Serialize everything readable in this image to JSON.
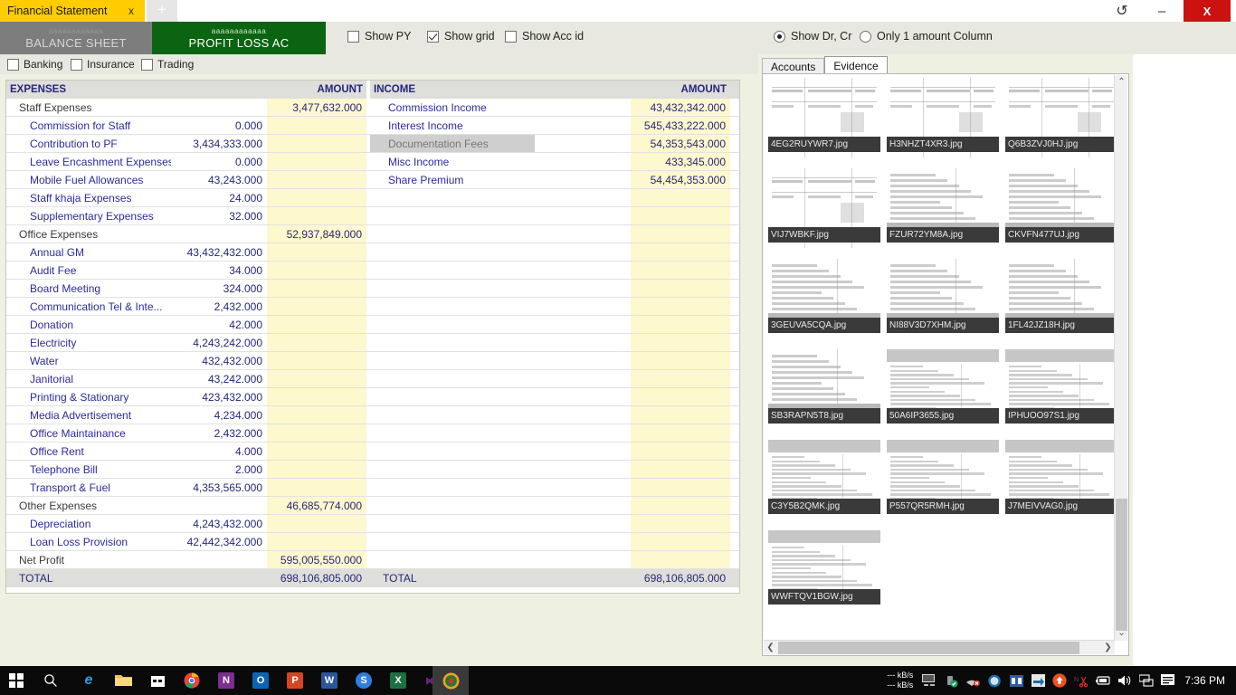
{
  "window": {
    "tab_title": "Financial Statement",
    "tab_close": "x",
    "new_tab": "+",
    "refresh": "↺",
    "minimize": "–",
    "close": "X"
  },
  "module_tabs": [
    {
      "sub": "aaaaaaaaaaaa",
      "main": "BALANCE SHEET",
      "active": false
    },
    {
      "sub": "aaaaaaaaaaaa",
      "main": "PROFIT  LOSS AC",
      "active": true
    }
  ],
  "options": {
    "show_py": "Show PY",
    "show_py_checked": false,
    "show_grid": "Show grid",
    "show_grid_checked": true,
    "show_acc_id": "Show Acc id",
    "show_acc_id_checked": false,
    "show_dr_cr": "Show Dr, Cr",
    "show_dr_cr_selected": true,
    "only_one_amount": "Only 1 amount Column",
    "only_one_amount_selected": false
  },
  "sub_options": {
    "banking": "Banking",
    "banking_checked": false,
    "insurance": "Insurance",
    "insurance_checked": false,
    "trading": "Trading",
    "trading_checked": false
  },
  "statement": {
    "left_header": "EXPENSES",
    "left_amount_header": "AMOUNT",
    "right_header": "INCOME",
    "right_amount_header": "AMOUNT",
    "total_label_left": "TOTAL",
    "total_value_left": "698,106,805.000",
    "total_label_right": "TOTAL",
    "total_value_right": "698,106,805.000",
    "expenses": [
      {
        "name": "Staff Expenses",
        "kind": "group",
        "amount1": "",
        "amount2": "3,477,632.000"
      },
      {
        "name": "Commission for Staff",
        "kind": "item",
        "amount1": "0.000",
        "amount2": ""
      },
      {
        "name": "Contribution to PF",
        "kind": "item",
        "amount1": "3,434,333.000",
        "amount2": ""
      },
      {
        "name": "Leave Encashment Expenses",
        "kind": "item",
        "amount1": "0.000",
        "amount2": ""
      },
      {
        "name": "Mobile Fuel Allowances",
        "kind": "item",
        "amount1": "43,243.000",
        "amount2": ""
      },
      {
        "name": "Staff khaja Expenses",
        "kind": "item",
        "amount1": "24.000",
        "amount2": ""
      },
      {
        "name": "Supplementary Expenses",
        "kind": "item",
        "amount1": "32.000",
        "amount2": ""
      },
      {
        "name": "Office Expenses",
        "kind": "group",
        "amount1": "",
        "amount2": "52,937,849.000"
      },
      {
        "name": "Annual GM",
        "kind": "item",
        "amount1": "43,432,432.000",
        "amount2": ""
      },
      {
        "name": "Audit Fee",
        "kind": "item",
        "amount1": "34.000",
        "amount2": ""
      },
      {
        "name": "Board Meeting",
        "kind": "item",
        "amount1": "324.000",
        "amount2": ""
      },
      {
        "name": "Communication Tel & Inte...",
        "kind": "item",
        "amount1": "2,432.000",
        "amount2": ""
      },
      {
        "name": "Donation",
        "kind": "item",
        "amount1": "42.000",
        "amount2": ""
      },
      {
        "name": "Electricity",
        "kind": "item",
        "amount1": "4,243,242.000",
        "amount2": ""
      },
      {
        "name": "Water",
        "kind": "item",
        "amount1": "432,432.000",
        "amount2": ""
      },
      {
        "name": "Janitorial",
        "kind": "item",
        "amount1": "43,242.000",
        "amount2": ""
      },
      {
        "name": "Printing & Stationary",
        "kind": "item",
        "amount1": "423,432.000",
        "amount2": ""
      },
      {
        "name": "Media Advertisement",
        "kind": "item",
        "amount1": "4,234.000",
        "amount2": ""
      },
      {
        "name": "Office Maintainance",
        "kind": "item",
        "amount1": "2,432.000",
        "amount2": ""
      },
      {
        "name": "Office Rent",
        "kind": "item",
        "amount1": "4.000",
        "amount2": ""
      },
      {
        "name": "Telephone Bill",
        "kind": "item",
        "amount1": "2.000",
        "amount2": ""
      },
      {
        "name": "Transport & Fuel",
        "kind": "item",
        "amount1": "4,353,565.000",
        "amount2": ""
      },
      {
        "name": "Other Expenses",
        "kind": "group",
        "amount1": "",
        "amount2": "46,685,774.000"
      },
      {
        "name": "Depreciation",
        "kind": "item",
        "amount1": "4,243,432.000",
        "amount2": ""
      },
      {
        "name": "Loan Loss Provision",
        "kind": "item",
        "amount1": "42,442,342.000",
        "amount2": ""
      },
      {
        "name": "Net Profit",
        "kind": "group",
        "amount1": "",
        "amount2": "595,005,550.000"
      }
    ],
    "income": [
      {
        "name": "Commission Income",
        "amount1": "",
        "amount2": "43,432,342.000",
        "selected": false
      },
      {
        "name": "Interest Income",
        "amount1": "",
        "amount2": "545,433,222.000",
        "selected": false
      },
      {
        "name": "Documentation Fees",
        "amount1": "",
        "amount2": "54,353,543.000",
        "selected": true
      },
      {
        "name": "Misc Income",
        "amount1": "",
        "amount2": "433,345.000",
        "selected": false
      },
      {
        "name": "Share Premium",
        "amount1": "",
        "amount2": "54,454,353.000",
        "selected": false
      }
    ]
  },
  "evidence": {
    "tabs": [
      {
        "label": "Accounts",
        "active": false
      },
      {
        "label": "Evidence",
        "active": true
      }
    ],
    "scroll_up": "⌃",
    "scroll_down": "⌄",
    "scroll_left": "❮",
    "scroll_right": "❯",
    "thumbnails": [
      {
        "file": "4EG2RUYWR7.jpg",
        "style": "receipt"
      },
      {
        "file": "H3NHZT4XR3.jpg",
        "style": "receipt"
      },
      {
        "file": "Q6B3ZVJ0HJ.jpg",
        "style": "receipt"
      },
      {
        "file": "VIJ7WBKF.jpg",
        "style": "receipt"
      },
      {
        "file": "FZUR72YM8A.jpg",
        "style": "ledger"
      },
      {
        "file": "CKVFN477UJ.jpg",
        "style": "ledger"
      },
      {
        "file": "3GEUVA5CQA.jpg",
        "style": "ledger"
      },
      {
        "file": "NI88V3D7XHM.jpg",
        "style": "ledger"
      },
      {
        "file": "1FL42JZ18H.jpg",
        "style": "ledger"
      },
      {
        "file": "SB3RAPN5T8.jpg",
        "style": "ledger"
      },
      {
        "file": "50A6IP3655.jpg",
        "style": "table"
      },
      {
        "file": "IPHUOO97S1.jpg",
        "style": "table"
      },
      {
        "file": "C3Y5B2QMK.jpg",
        "style": "table"
      },
      {
        "file": "P557QR5RMH.jpg",
        "style": "table"
      },
      {
        "file": "J7MEIVVAG0.jpg",
        "style": "table"
      },
      {
        "file": "WWFTQV1BGW.jpg",
        "style": "table"
      }
    ]
  },
  "taskbar": {
    "start": "⊞",
    "search": "search-icon",
    "apps": [
      {
        "name": "edge",
        "glyph": "e",
        "color": "#0a0a0a",
        "text_color": "#2f9ee0"
      },
      {
        "name": "explorer",
        "glyph": "",
        "color": "#f2c14a",
        "text_color": "#ffffff"
      },
      {
        "name": "store",
        "glyph": "",
        "color": "#ffffff",
        "text_color": "#0a0a0a"
      },
      {
        "name": "chrome",
        "glyph": "",
        "color": "#e8453c",
        "text_color": "#ffffff"
      },
      {
        "name": "onenote",
        "glyph": "N",
        "color": "#7b2f8e",
        "text_color": "#ffffff"
      },
      {
        "name": "outlook",
        "glyph": "O",
        "color": "#0a66b5",
        "text_color": "#ffffff"
      },
      {
        "name": "powerpoint",
        "glyph": "P",
        "color": "#d24625",
        "text_color": "#ffffff"
      },
      {
        "name": "word",
        "glyph": "W",
        "color": "#2b579a",
        "text_color": "#ffffff"
      },
      {
        "name": "skype",
        "glyph": "S",
        "color": "#2f7de1",
        "text_color": "#ffffff"
      },
      {
        "name": "excel",
        "glyph": "X",
        "color": "#1d6f42",
        "text_color": "#ffffff"
      },
      {
        "name": "visualstudio",
        "glyph": "",
        "color": "#68217a",
        "text_color": "#ffffff"
      },
      {
        "name": "app-active",
        "glyph": "",
        "color": "#c03a2b",
        "text_color": "#ffffff"
      }
    ],
    "net_up": "--- kB/s",
    "net_down": "--- kB/s",
    "clock": "7:36 PM"
  }
}
